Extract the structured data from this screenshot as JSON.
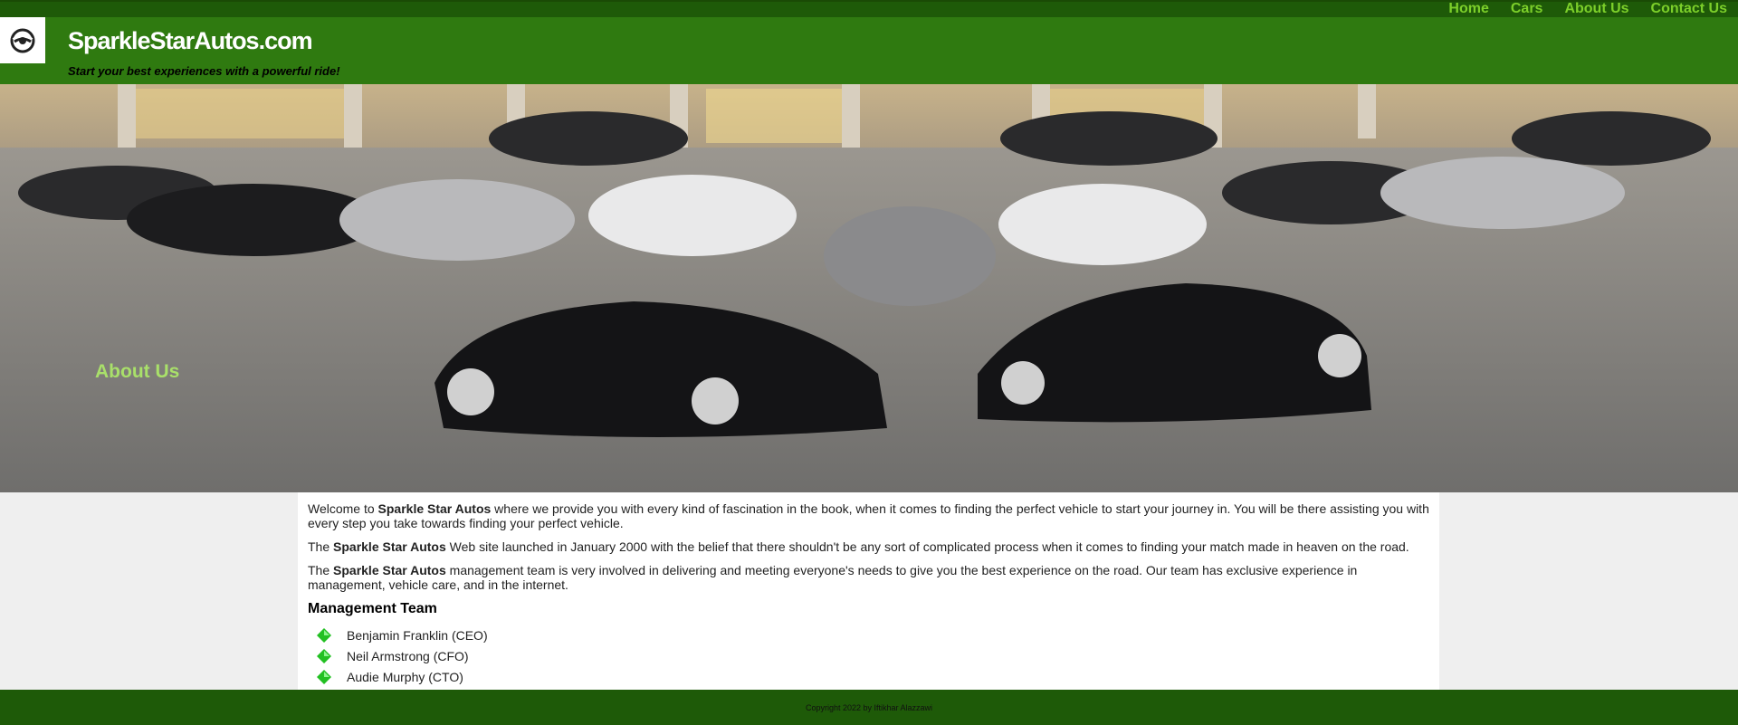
{
  "header": {
    "brand": "SparkleStarAutos.com",
    "tagline": "Start your best experiences with a powerful ride!",
    "logo_icon": "swirl-logo-icon"
  },
  "nav": {
    "items": [
      "Home",
      "Cars",
      "About Us",
      "Contact Us"
    ]
  },
  "hero": {
    "title": "About Us",
    "image": "dealership-cars-photo"
  },
  "content": {
    "p1": {
      "pre": "Welcome to ",
      "bold": "Sparkle Star Autos",
      "post": " where we provide you with every kind of fascination in the book, when it comes to finding the perfect vehicle to start your journey in. You will be there assisting you with every step you take towards finding your perfect vehicle."
    },
    "p2": {
      "pre": "The ",
      "bold": "Sparkle Star Autos",
      "post": " Web site launched in January 2000 with the belief that there shouldn't be any sort of complicated process when it comes to finding your match made in heaven on the road."
    },
    "p3": {
      "pre": "The ",
      "bold": "Sparkle Star Autos",
      "post": " management team is very involved in delivering and meeting everyone's needs to give you the best experience on the road. Our team has exclusive experience in management, vehicle care, and in the internet."
    },
    "team_heading": "Management Team",
    "team": [
      "Benjamin Franklin (CEO)",
      "Neil Armstrong (CFO)",
      "Audie Murphy (CTO)"
    ]
  },
  "footer": {
    "copyright": "Copyright 2022 by Iftikhar Alazzawi"
  },
  "colors": {
    "header_green": "#2f7a10",
    "nav_green": "#1e5a08",
    "link_green": "#7ccf2a",
    "hero_title": "#a9e06a"
  }
}
